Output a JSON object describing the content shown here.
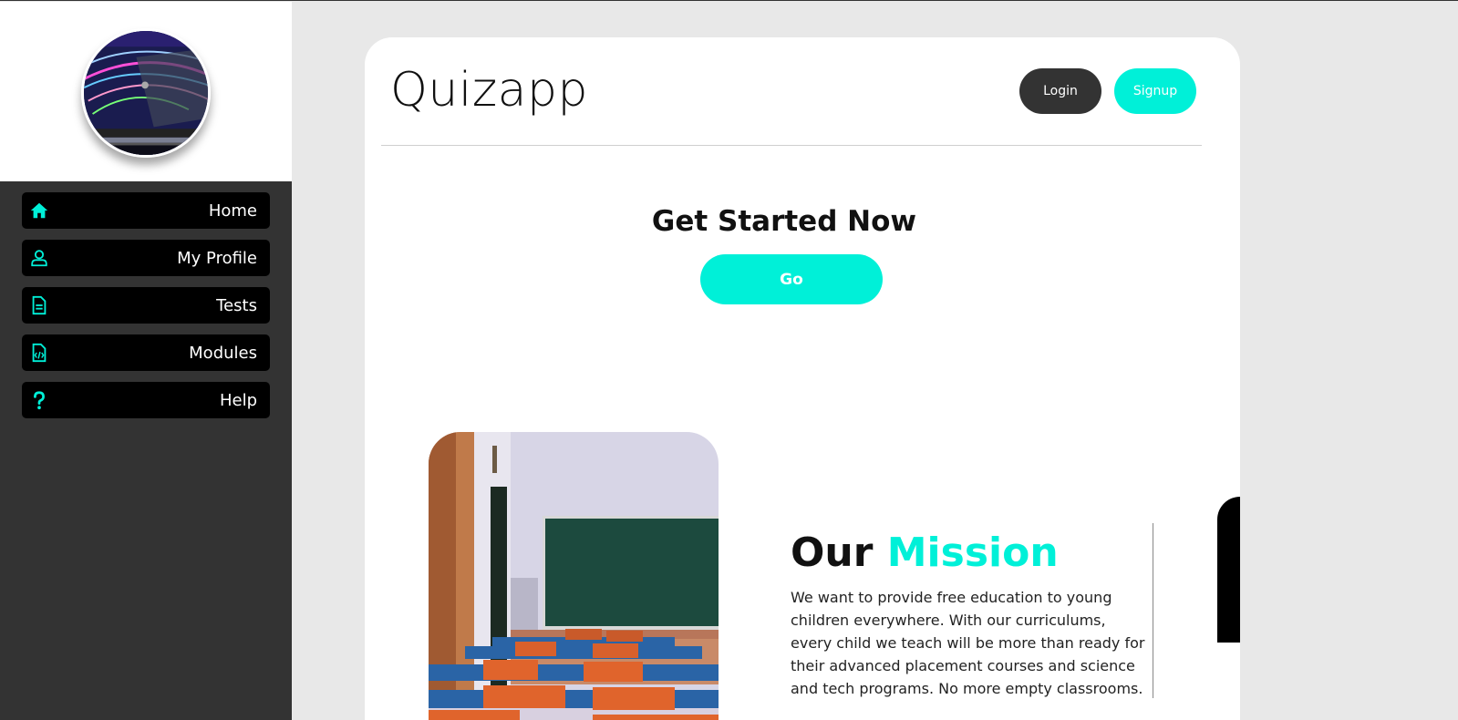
{
  "sidebar": {
    "items": [
      {
        "label": "Home",
        "icon": "home-icon"
      },
      {
        "label": "My Profile",
        "icon": "user-icon"
      },
      {
        "label": "Tests",
        "icon": "document-icon"
      },
      {
        "label": "Modules",
        "icon": "code-file-icon"
      },
      {
        "label": "Help",
        "icon": "question-icon"
      }
    ]
  },
  "header": {
    "brand": "Quizapp",
    "login_label": "Login",
    "signup_label": "Signup"
  },
  "cta": {
    "title": "Get Started Now",
    "go_label": "Go"
  },
  "mission": {
    "title_part1": "Our",
    "title_part2": "Mission",
    "text": "We want to provide free education to young children everywhere. With our curriculums, every child we teach will be more than ready for their advanced placement courses and science and tech programs. No more empty classrooms."
  },
  "colors": {
    "accent": "#00f0d8",
    "sidebar_bg": "#333333",
    "nav_item_bg": "#000000",
    "page_bg": "#e8e8e8"
  }
}
